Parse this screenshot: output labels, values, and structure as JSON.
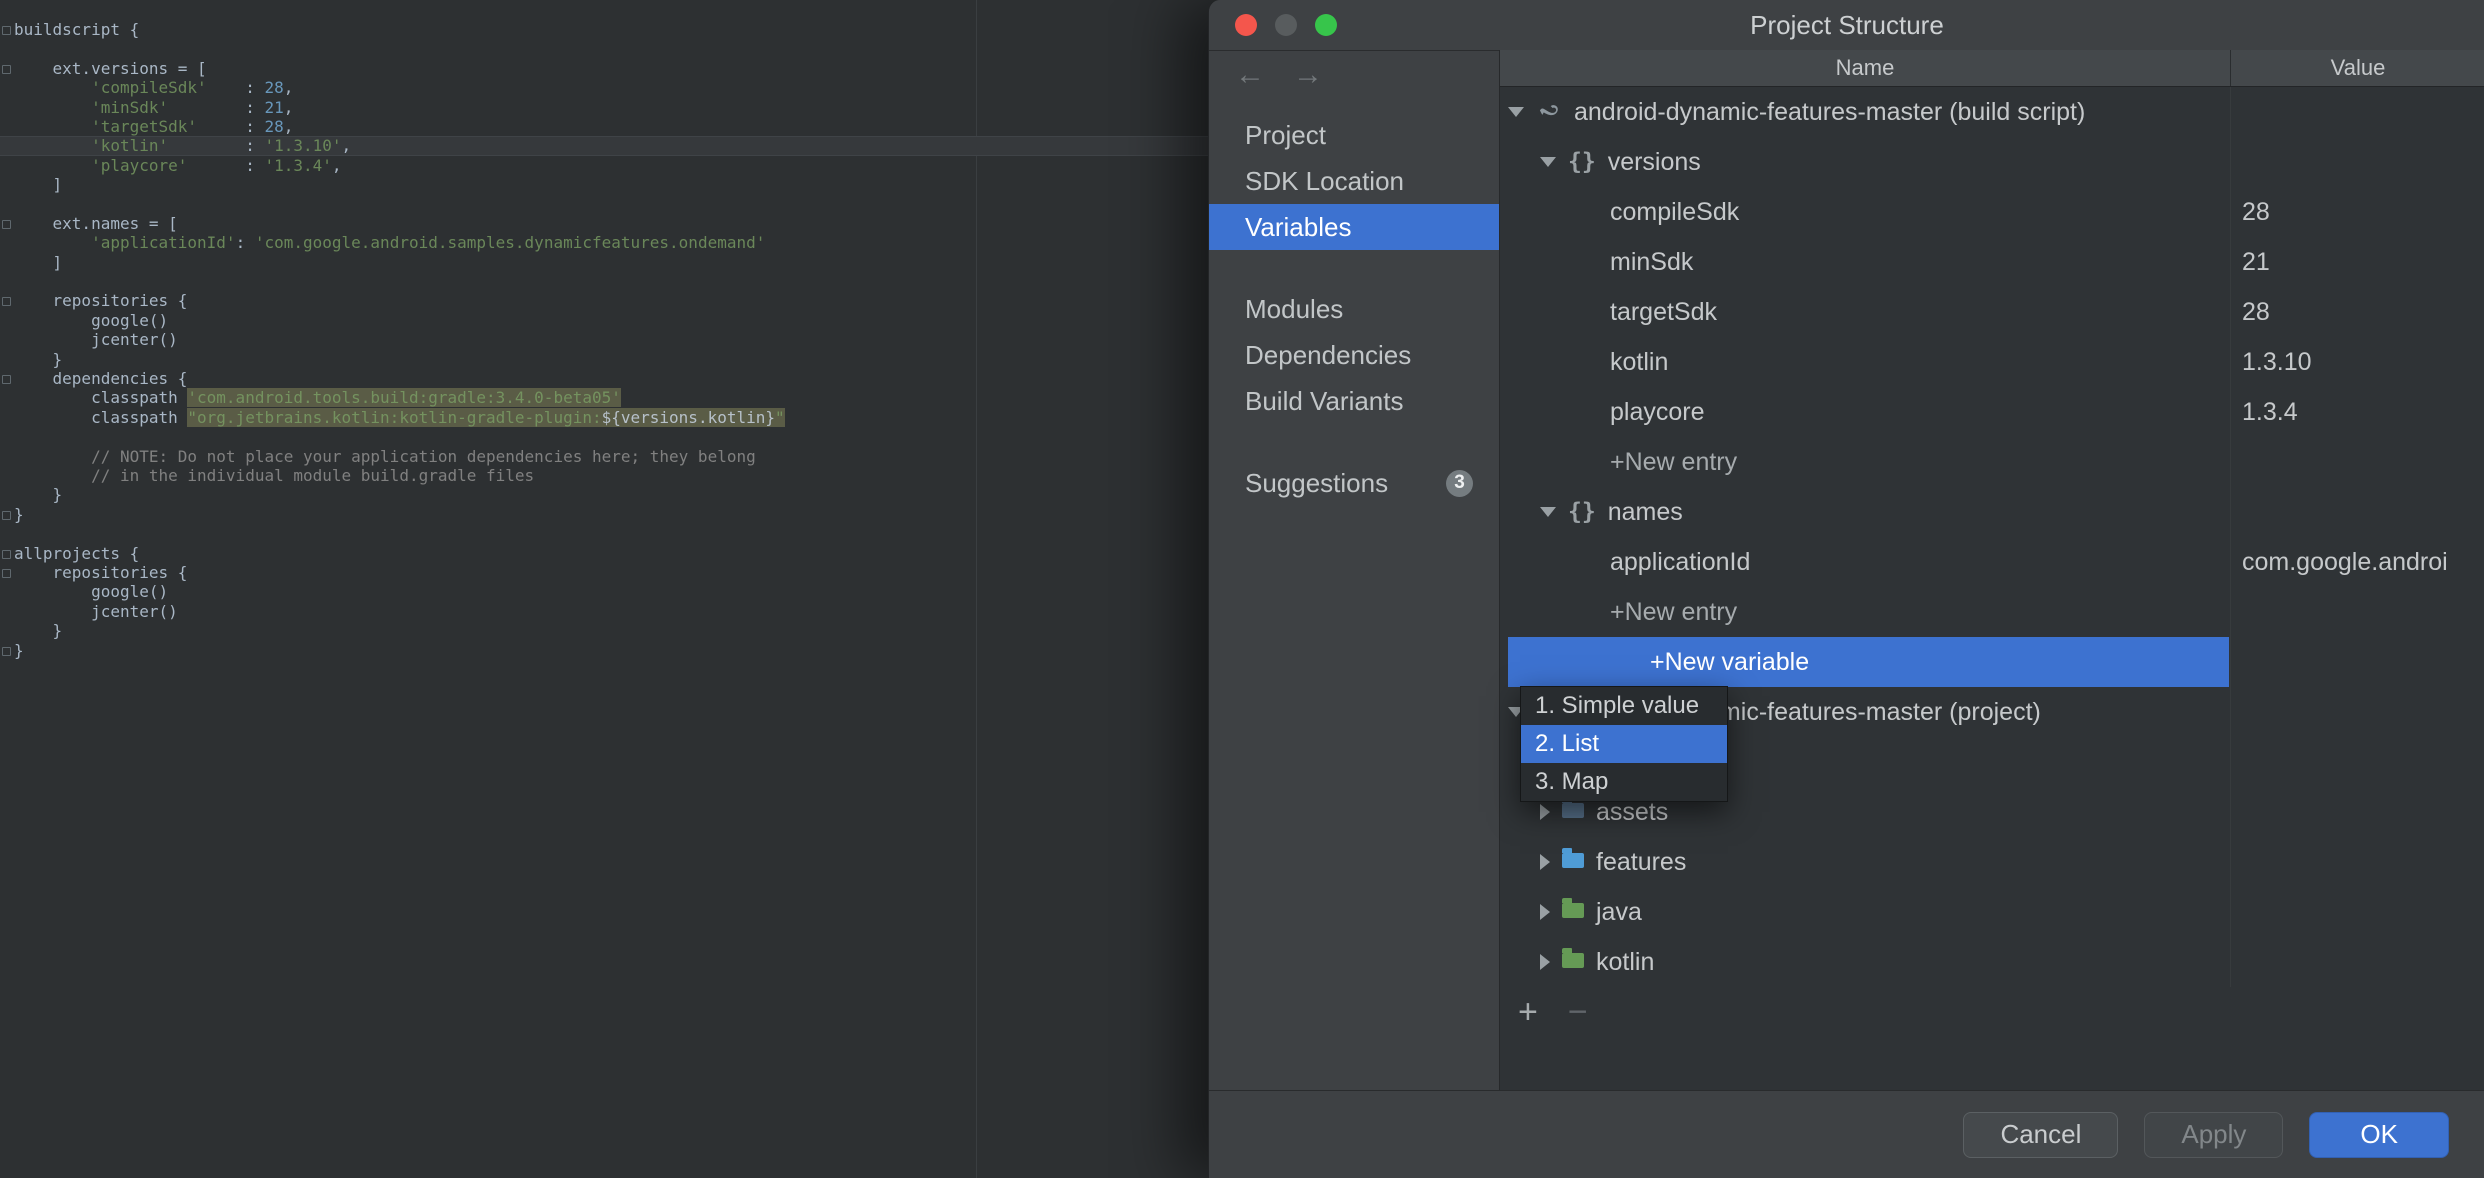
{
  "colors": {
    "accent": "#3d72d0",
    "traffic_close": "#f4564c",
    "traffic_minimize": "#585c5e",
    "traffic_zoom": "#37c54b",
    "editor_string": "#6a8759",
    "editor_number": "#6897bb",
    "editor_comment": "#808080",
    "editor_highlight_bg": "#5a5c46"
  },
  "icons": {
    "back_arrow": "←",
    "forward_arrow": "→",
    "braces_glyph": "{}",
    "add_glyph": "+",
    "remove_glyph": "−"
  },
  "editor": {
    "lines": [
      {
        "fold": true,
        "segments": [
          {
            "t": "buildscript {",
            "c": "d"
          }
        ]
      },
      {
        "segments": []
      },
      {
        "fold": true,
        "segments": [
          {
            "t": "    ext.versions = [",
            "c": "d"
          }
        ]
      },
      {
        "segments": [
          {
            "t": "        ",
            "c": "d"
          },
          {
            "t": "'compileSdk'",
            "c": "s"
          },
          {
            "t": "    : ",
            "c": "d"
          },
          {
            "t": "28",
            "c": "n"
          },
          {
            "t": ",",
            "c": "d"
          }
        ]
      },
      {
        "segments": [
          {
            "t": "        ",
            "c": "d"
          },
          {
            "t": "'minSdk'",
            "c": "s"
          },
          {
            "t": "        : ",
            "c": "d"
          },
          {
            "t": "21",
            "c": "n"
          },
          {
            "t": ",",
            "c": "d"
          }
        ]
      },
      {
        "segments": [
          {
            "t": "        ",
            "c": "d"
          },
          {
            "t": "'targetSdk'",
            "c": "s"
          },
          {
            "t": "     : ",
            "c": "d"
          },
          {
            "t": "28",
            "c": "n"
          },
          {
            "t": ",",
            "c": "d"
          }
        ]
      },
      {
        "caret": true,
        "segments": [
          {
            "t": "        ",
            "c": "d"
          },
          {
            "t": "'kotlin'",
            "c": "s"
          },
          {
            "t": "        : ",
            "c": "d"
          },
          {
            "t": "'1.3.10'",
            "c": "s"
          },
          {
            "t": ",",
            "c": "d"
          }
        ]
      },
      {
        "segments": [
          {
            "t": "        ",
            "c": "d"
          },
          {
            "t": "'playcore'",
            "c": "s"
          },
          {
            "t": "      : ",
            "c": "d"
          },
          {
            "t": "'1.3.4'",
            "c": "s"
          },
          {
            "t": ",",
            "c": "d"
          }
        ]
      },
      {
        "segments": [
          {
            "t": "    ]",
            "c": "d"
          }
        ]
      },
      {
        "segments": []
      },
      {
        "fold": true,
        "segments": [
          {
            "t": "    ext.names = [",
            "c": "d"
          }
        ]
      },
      {
        "segments": [
          {
            "t": "        ",
            "c": "d"
          },
          {
            "t": "'applicationId'",
            "c": "s"
          },
          {
            "t": ": ",
            "c": "d"
          },
          {
            "t": "'com.google.android.samples.dynamicfeatures.ondemand'",
            "c": "s"
          }
        ]
      },
      {
        "segments": [
          {
            "t": "    ]",
            "c": "d"
          }
        ]
      },
      {
        "segments": []
      },
      {
        "fold": true,
        "segments": [
          {
            "t": "    repositories {",
            "c": "d"
          }
        ]
      },
      {
        "segments": [
          {
            "t": "        google()",
            "c": "d"
          }
        ]
      },
      {
        "segments": [
          {
            "t": "        jcenter()",
            "c": "d"
          }
        ]
      },
      {
        "segments": [
          {
            "t": "    }",
            "c": "d"
          }
        ]
      },
      {
        "fold": true,
        "segments": [
          {
            "t": "    dependencies {",
            "c": "d"
          }
        ]
      },
      {
        "segments": [
          {
            "t": "        classpath ",
            "c": "d"
          },
          {
            "t": "'com.android.tools.build:gradle:3.4.0-beta05'",
            "c": "hs"
          }
        ]
      },
      {
        "segments": [
          {
            "t": "        classpath ",
            "c": "d"
          },
          {
            "t": "\"org.jetbrains.kotlin:kotlin-gradle-plugin:",
            "c": "hs"
          },
          {
            "t": "${versions.kotlin}",
            "c": "hd"
          },
          {
            "t": "\"",
            "c": "hs"
          }
        ]
      },
      {
        "segments": []
      },
      {
        "segments": [
          {
            "t": "        // NOTE: Do not place your application dependencies here; they belong",
            "c": "c"
          }
        ]
      },
      {
        "segments": [
          {
            "t": "        // in the individual module build.gradle files",
            "c": "c"
          }
        ]
      },
      {
        "segments": [
          {
            "t": "    }",
            "c": "d"
          }
        ]
      },
      {
        "fold": true,
        "segments": [
          {
            "t": "}",
            "c": "d"
          }
        ]
      },
      {
        "segments": []
      },
      {
        "fold": true,
        "segments": [
          {
            "t": "allprojects {",
            "c": "d"
          }
        ]
      },
      {
        "fold": true,
        "segments": [
          {
            "t": "    repositories {",
            "c": "d"
          }
        ]
      },
      {
        "segments": [
          {
            "t": "        google()",
            "c": "d"
          }
        ]
      },
      {
        "segments": [
          {
            "t": "        jcenter()",
            "c": "d"
          }
        ]
      },
      {
        "segments": [
          {
            "t": "    }",
            "c": "d"
          }
        ]
      },
      {
        "fold": true,
        "segments": [
          {
            "t": "}",
            "c": "d"
          }
        ]
      }
    ]
  },
  "dialog": {
    "title": "Project Structure",
    "nav": {
      "items": [
        {
          "label": "Project"
        },
        {
          "label": "SDK Location"
        },
        {
          "label": "Variables",
          "selected": true
        },
        {
          "spacer": true
        },
        {
          "label": "Modules"
        },
        {
          "label": "Dependencies"
        },
        {
          "label": "Build Variants"
        },
        {
          "spacer": true
        },
        {
          "label": "Suggestions",
          "badge": "3"
        }
      ]
    },
    "table": {
      "columns": [
        "Name",
        "Value"
      ],
      "rows": [
        {
          "indent": 0,
          "expand": "open",
          "icon": "gradle",
          "name": "android-dynamic-features-master (build script)"
        },
        {
          "indent": 1,
          "expand": "open",
          "icon": "braces",
          "name": "versions"
        },
        {
          "indent": 2,
          "name": "compileSdk",
          "value": "28"
        },
        {
          "indent": 2,
          "name": "minSdk",
          "value": "21"
        },
        {
          "indent": 2,
          "name": "targetSdk",
          "value": "28"
        },
        {
          "indent": 2,
          "name": "kotlin",
          "value": "1.3.10"
        },
        {
          "indent": 2,
          "name": "playcore",
          "value": "1.3.4"
        },
        {
          "indent": 2,
          "name": "+New entry",
          "muted": true
        },
        {
          "indent": 1,
          "expand": "open",
          "icon": "braces",
          "name": "names"
        },
        {
          "indent": 2,
          "name": "applicationId",
          "value": "com.google.androi"
        },
        {
          "indent": 2,
          "name": "+New entry",
          "muted": true
        },
        {
          "editing": true,
          "name": "+New variable"
        },
        {
          "indent": 0,
          "expand": "open",
          "icon": "gradle",
          "name": "android-dynamic-features-master (project)"
        },
        {
          "empty": true
        },
        {
          "indent": 1,
          "expand": "closed",
          "icon": "folder",
          "icon_color": "#56708a",
          "name": "assets"
        },
        {
          "indent": 1,
          "expand": "closed",
          "icon": "folder",
          "icon_color": "#4f9cd6",
          "name": "features"
        },
        {
          "indent": 1,
          "expand": "closed",
          "icon": "folder",
          "icon_color": "#659a55",
          "name": "java"
        },
        {
          "indent": 1,
          "expand": "closed",
          "icon": "folder",
          "icon_color": "#659a55",
          "name": "kotlin"
        }
      ]
    },
    "dropdown": {
      "items": [
        "1. Simple value",
        "2. List",
        "3. Map"
      ],
      "selected_index": 1
    },
    "buttons": {
      "cancel": "Cancel",
      "apply": "Apply",
      "ok": "OK"
    }
  }
}
